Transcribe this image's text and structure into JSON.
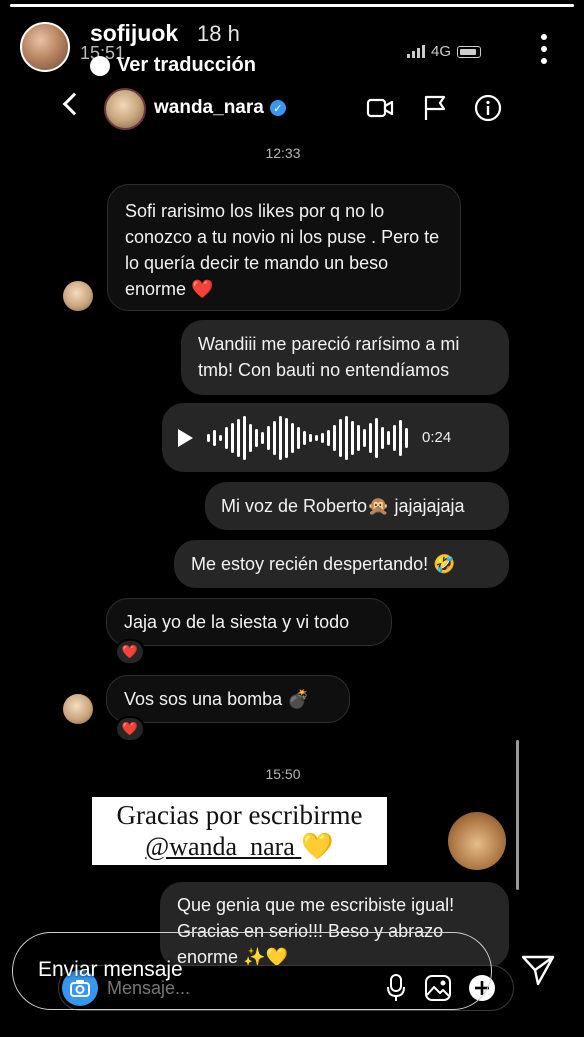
{
  "story": {
    "progress": 1.0,
    "username": "sofijuok",
    "time_ago": "18 h",
    "translate_label": "Ver traducción"
  },
  "status_bar": {
    "time": "15:51",
    "network": "4G"
  },
  "dm_header": {
    "username": "wanda_nara"
  },
  "chat": {
    "timestamp_1": "12:33",
    "msg_1": "Sofi rarisimo los likes por q no lo conozco a tu novio ni los puse . Pero te lo quería decir te mando un beso enorme ❤️",
    "msg_2": "Wandiii me pareció rarísimo a mi tmb!  Con bauti no entendíamos",
    "voice_duration": "0:24",
    "msg_3": "Mi voz de Roberto🙊 jajajajaja",
    "msg_4": "Me estoy recién despertando! 🤣",
    "msg_5": "Jaja yo de la siesta y vi todo",
    "reaction_5": "❤️",
    "msg_6": "Vos sos una bomba 💣",
    "reaction_6": "❤️",
    "timestamp_2": "15:50",
    "msg_7": "Que genia que me escribiste igual! Gracias en serio!!! Beso y abrazo enorme ✨💛"
  },
  "sticker": {
    "line1": "Gracias por escribirme",
    "line2": "@wanda_nara",
    "emoji": "💛",
    "monkey_emoji": "🙈"
  },
  "composer": {
    "placeholder": "Mensaje..."
  },
  "reply": {
    "placeholder": "Enviar mensaje"
  },
  "colors": {
    "background": "#000000",
    "bubble_out": "#262626",
    "verified": "#3897f0",
    "camera": "#3797f0"
  }
}
